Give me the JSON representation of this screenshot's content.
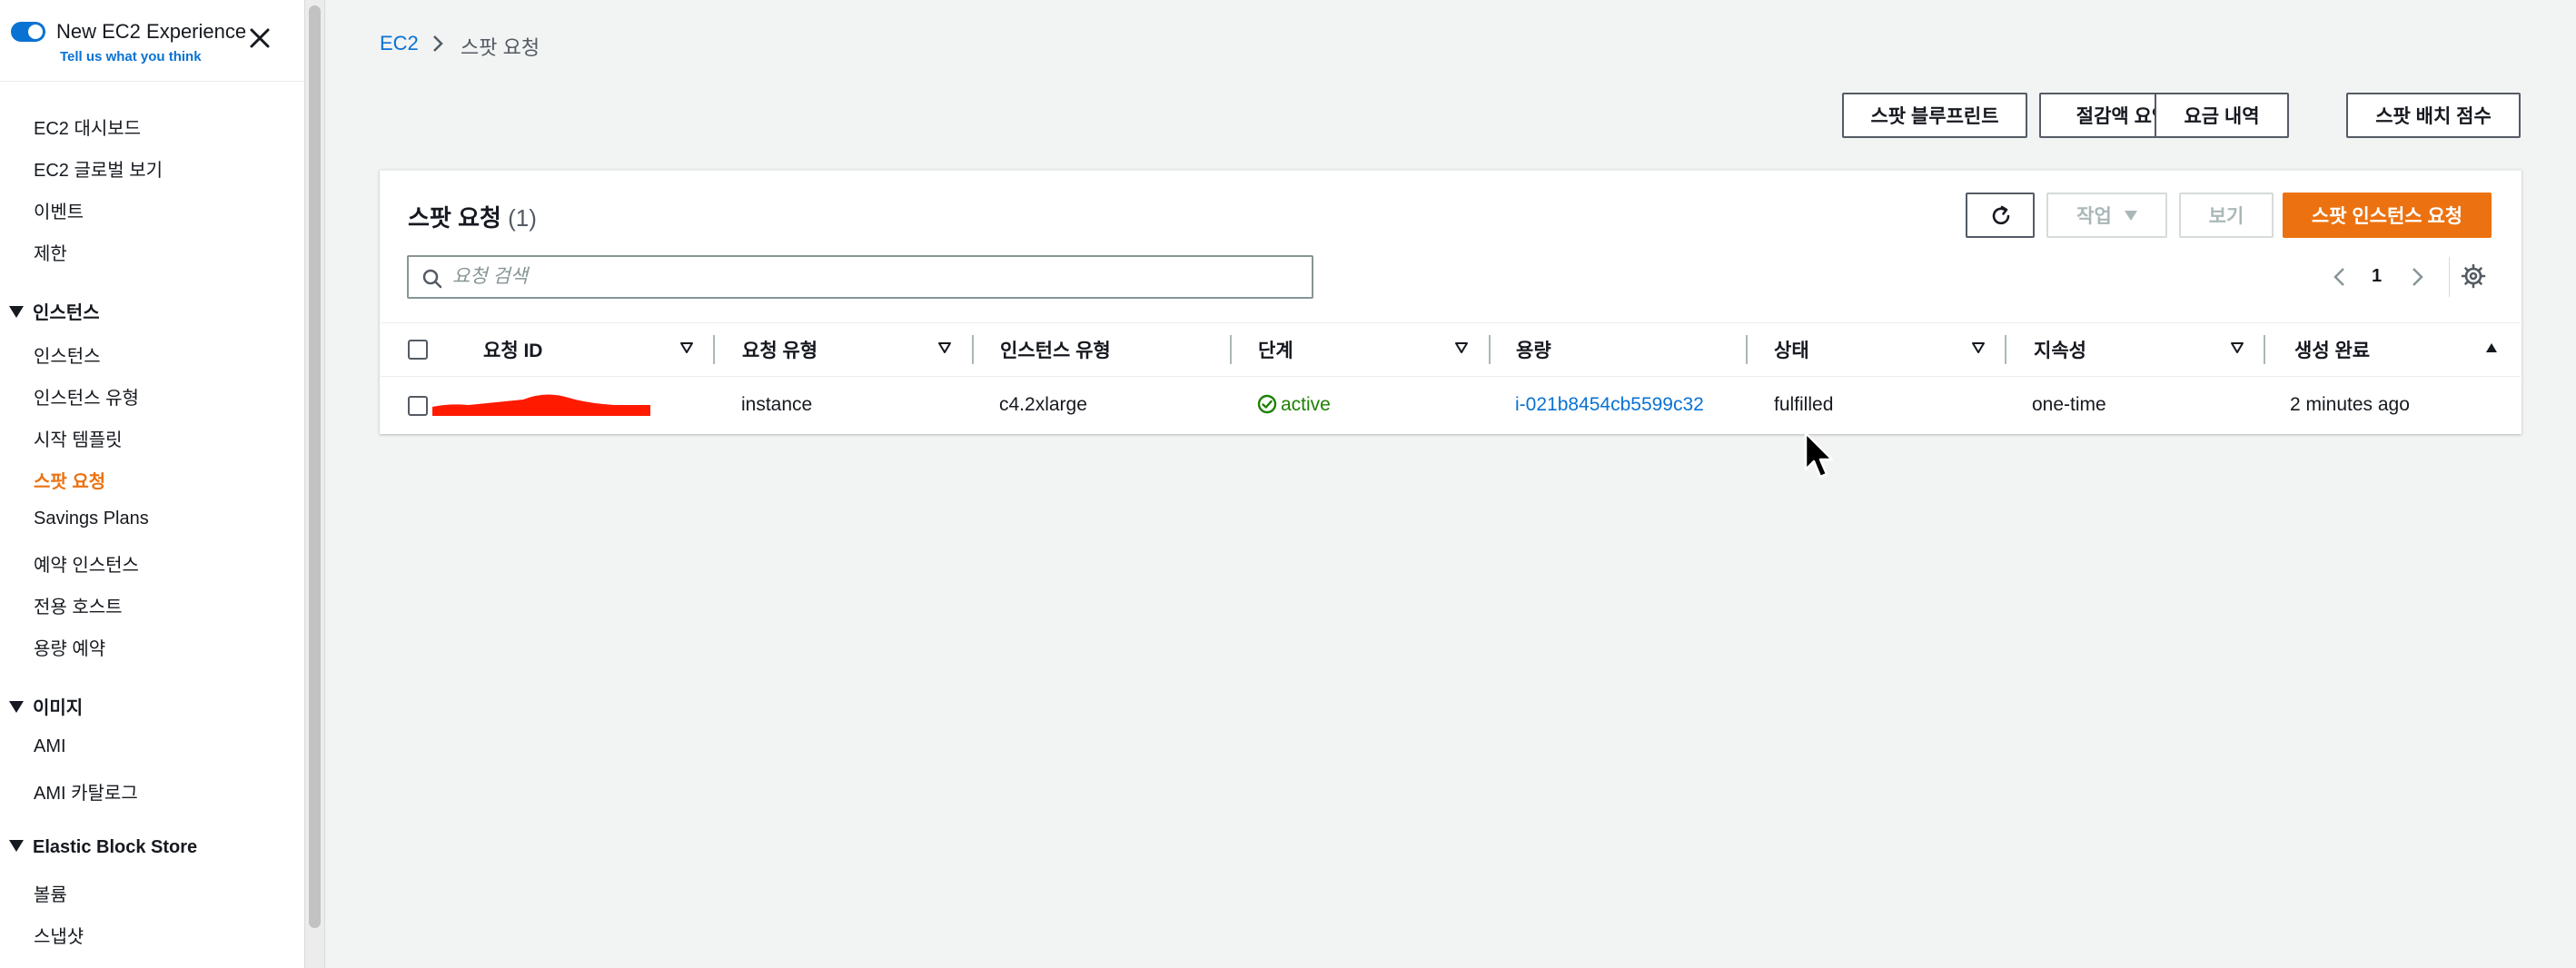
{
  "experience": {
    "title": "New EC2 Experience",
    "feedback_link": "Tell us what you think"
  },
  "sidebar": {
    "items_top": [
      "EC2 대시보드",
      "EC2 글로벌 보기",
      "이벤트",
      "제한"
    ],
    "sections": [
      {
        "title": "인스턴스",
        "items": [
          "인스턴스",
          "인스턴스 유형",
          "시작 템플릿",
          "스팟 요청",
          "Savings Plans",
          "예약 인스턴스",
          "전용 호스트",
          "용량 예약"
        ]
      },
      {
        "title": "이미지",
        "items": [
          "AMI",
          "AMI 카탈로그"
        ]
      },
      {
        "title": "Elastic Block Store",
        "items": [
          "볼륨",
          "스냅샷"
        ]
      }
    ],
    "active_item": "스팟 요청"
  },
  "breadcrumb": {
    "root": "EC2",
    "current": "스팟 요청"
  },
  "top_buttons": [
    "스팟 블루프린트",
    "절감액 요약",
    "요금 내역",
    "스팟 배치 점수"
  ],
  "panel": {
    "title": "스팟 요청",
    "count": "(1)",
    "actions_label": "작업",
    "view_label": "보기",
    "primary_label": "스팟 인스턴스 요청",
    "search_placeholder": "요청 검색",
    "page": "1"
  },
  "table": {
    "columns": [
      "요청 ID",
      "요청 유형",
      "인스턴스 유형",
      "단계",
      "용량",
      "상태",
      "지속성",
      "생성 완료"
    ],
    "rows": [
      {
        "request_id": "",
        "request_type": "instance",
        "instance_type": "c4.2xlarge",
        "stage": "active",
        "capacity": "i-021b8454cb5599c32",
        "status": "fulfilled",
        "persistence": "one-time",
        "created": "2 minutes ago"
      }
    ]
  },
  "colors": {
    "accent": "#ec7211",
    "link": "#0972d3",
    "success": "#1d8102",
    "redaction": "#ff1a00"
  },
  "icons": [
    "close-icon",
    "chevron-right-icon",
    "refresh-icon",
    "search-icon",
    "chevron-left-icon",
    "settings-gear-icon",
    "check-circle-icon",
    "sort-down-icon",
    "sort-up-icon",
    "mouse-cursor-icon"
  ]
}
